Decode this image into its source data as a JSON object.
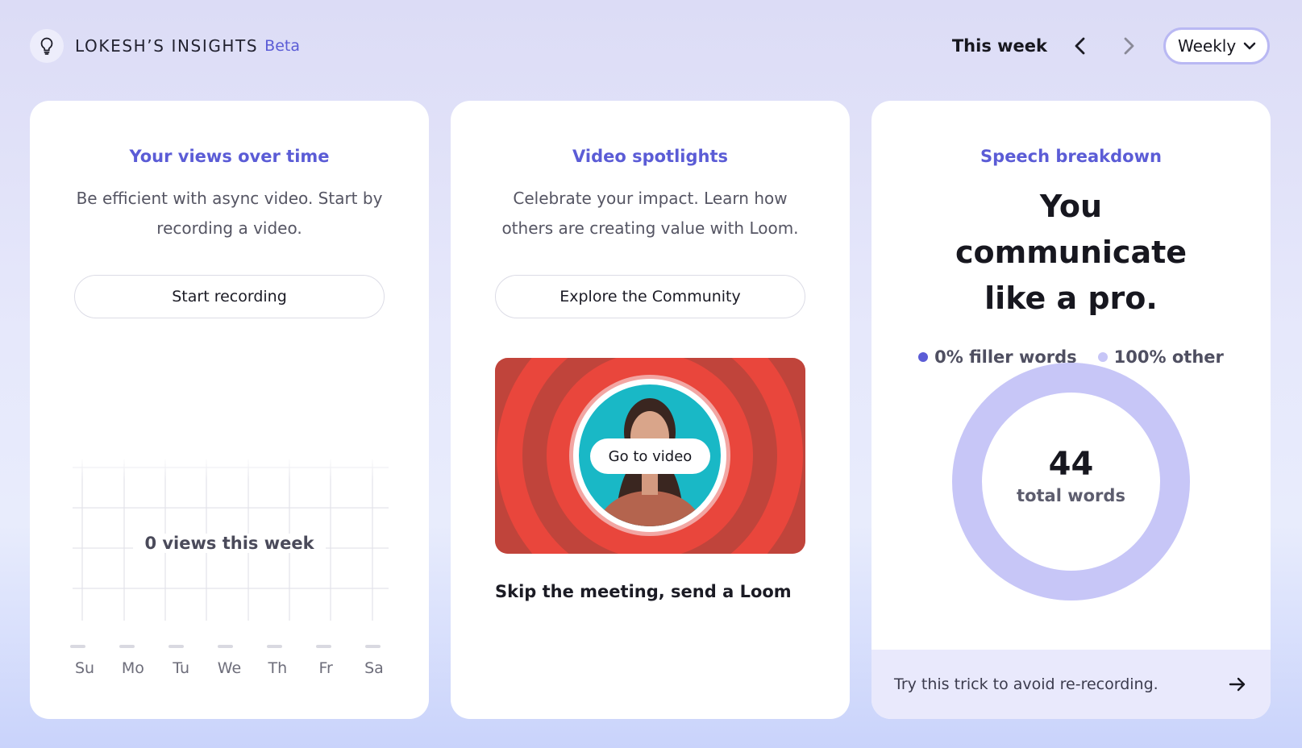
{
  "header": {
    "title": "LOKESH’S INSIGHTS",
    "badge": "Beta",
    "period_label": "This week",
    "range_select": "Weekly"
  },
  "views_card": {
    "title": "Your views over time",
    "description": "Be efficient with async video. Start by recording a video.",
    "button": "Start recording",
    "chart_label": "0 views this week",
    "days": [
      "Su",
      "Mo",
      "Tu",
      "We",
      "Th",
      "Fr",
      "Sa"
    ]
  },
  "spotlight_card": {
    "title": "Video spotlights",
    "description": "Celebrate your impact. Learn how others are creating value with Loom.",
    "button": "Explore the Community",
    "thumbnail_button": "Go to video",
    "caption": "Skip the meeting, send a Loom"
  },
  "speech_card": {
    "title": "Speech breakdown",
    "headline": "You communicate like a pro.",
    "legend": [
      {
        "label": "0% filler words",
        "color": "#5b5cd6"
      },
      {
        "label": "100% other",
        "color": "#c7c6f7"
      }
    ],
    "total": "44",
    "total_label": "total words",
    "tip": "Try this trick to avoid re-recording."
  },
  "chart_data": {
    "type": "pie",
    "categories": [
      "filler words",
      "other"
    ],
    "values": [
      0,
      100
    ],
    "colors": [
      "#5b5cd6",
      "#c7c6f7"
    ],
    "total_words": 44
  }
}
